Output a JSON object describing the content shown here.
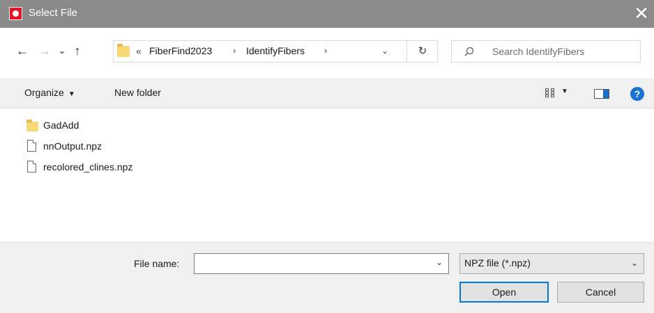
{
  "window": {
    "title": "Select File",
    "close_glyph": "✕"
  },
  "nav": {
    "back_glyph": "←",
    "forward_glyph": "→",
    "recent_glyph": "⌄",
    "up_glyph": "↑",
    "breadcrumb_overflow": "«",
    "breadcrumbs": [
      "FiberFind2023",
      "IdentifyFibers"
    ],
    "separator": "›",
    "dropdown_glyph": "⌄",
    "refresh_glyph": "↻"
  },
  "search": {
    "placeholder": "Search IdentifyFibers"
  },
  "toolbar": {
    "organize_label": "Organize",
    "caret": "▼",
    "new_folder_label": "New folder",
    "help_label": "?"
  },
  "files": [
    {
      "name": "GadAdd",
      "icon": "folder-icon"
    },
    {
      "name": "nnOutput.npz",
      "icon": "file-icon"
    },
    {
      "name": "recolored_clines.npz",
      "icon": "file-icon"
    }
  ],
  "footer": {
    "file_name_label": "File name:",
    "file_name_value": "",
    "filter_value": "NPZ file (*.npz)",
    "dropdown_glyph": "⌄",
    "open_label": "Open",
    "cancel_label": "Cancel"
  },
  "colors": {
    "titlebar": "#8a8a8a",
    "accent": "#0078d7",
    "app_icon": "#e81123",
    "folder": "#f8d775"
  }
}
